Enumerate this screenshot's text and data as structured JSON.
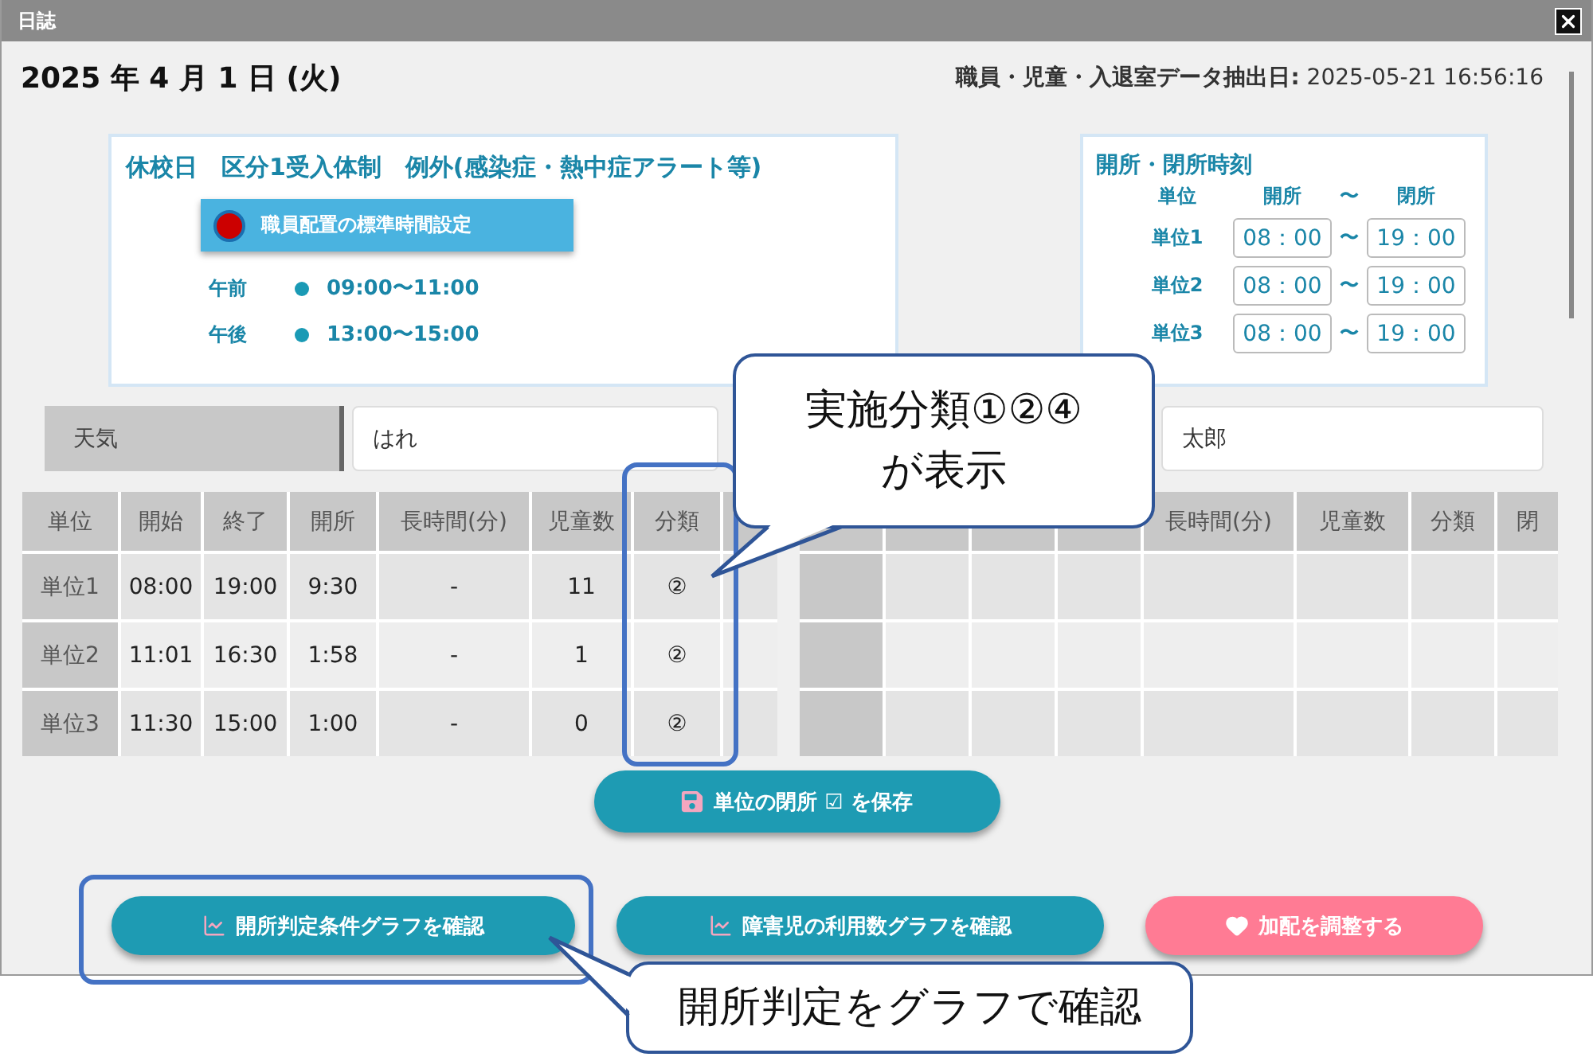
{
  "window": {
    "title": "日誌"
  },
  "date": "2025 年 4 月 1 日 (火)",
  "extract": {
    "label": "職員・児童・入退室データ抽出日:",
    "value": "2025-05-21 16:56:16"
  },
  "day_panel": {
    "title": "休校日　区分1受入体制　例外(感染症・熱中症アラート等)",
    "standard_button": "職員配置の標準時間設定",
    "sessions": [
      {
        "label": "午前",
        "time": "09:00〜11:00"
      },
      {
        "label": "午後",
        "time": "13:00〜15:00"
      }
    ]
  },
  "hours_panel": {
    "title": "開所・閉所時刻",
    "columns": [
      "単位",
      "開所",
      "〜",
      "閉所"
    ],
    "rows": [
      {
        "unit": "単位1",
        "open": "08：00",
        "sep": "〜",
        "close": "19：00"
      },
      {
        "unit": "単位2",
        "open": "08：00",
        "sep": "〜",
        "close": "19：00"
      },
      {
        "unit": "単位3",
        "open": "08：00",
        "sep": "〜",
        "close": "19：00"
      }
    ]
  },
  "weather": {
    "label": "天気",
    "value": "はれ"
  },
  "staff": {
    "value": "太郎"
  },
  "left_table": {
    "columns": [
      "単位",
      "開始",
      "終了",
      "開所",
      "長時間(分)",
      "児童数",
      "分類"
    ],
    "rows": [
      [
        "単位1",
        "08:00",
        "19:00",
        "9:30",
        "-",
        "11",
        "②"
      ],
      [
        "単位2",
        "11:01",
        "16:30",
        "1:58",
        "-",
        "1",
        "②"
      ],
      [
        "単位3",
        "11:30",
        "15:00",
        "1:00",
        "-",
        "0",
        "②"
      ]
    ]
  },
  "right_table": {
    "columns": [
      "長時間(分)",
      "児童数",
      "分類",
      "閉"
    ]
  },
  "save_button": "単位の閉所 ☑ を保存",
  "buttons": [
    {
      "label": "開所判定条件グラフを確認",
      "kind": "chart"
    },
    {
      "label": "障害児の利用数グラフを確認",
      "kind": "chart"
    },
    {
      "label": "加配を調整する",
      "kind": "heart"
    }
  ],
  "callouts": [
    {
      "text": "実施分類①②④\nが表示"
    },
    {
      "text": "開所判定をグラフで確認"
    }
  ]
}
